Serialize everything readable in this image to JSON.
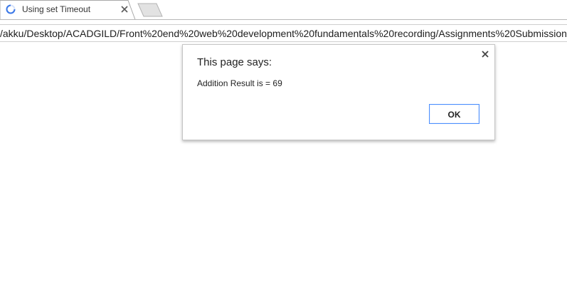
{
  "browser": {
    "tab": {
      "title": "Using set Timeout",
      "loading_icon": "spinner-icon",
      "close_icon": "close-icon"
    },
    "new_tab_icon": "new-tab-icon",
    "address_bar": {
      "url": "/akku/Desktop/ACADGILD/Front%20end%20web%20development%20fundamentals%20recording/Assignments%20Submission/"
    }
  },
  "dialog": {
    "title": "This page says:",
    "message": "Addition Result is = 69",
    "ok_label": "OK",
    "close_icon": "close-icon",
    "accent_color": "#4d90fe"
  }
}
